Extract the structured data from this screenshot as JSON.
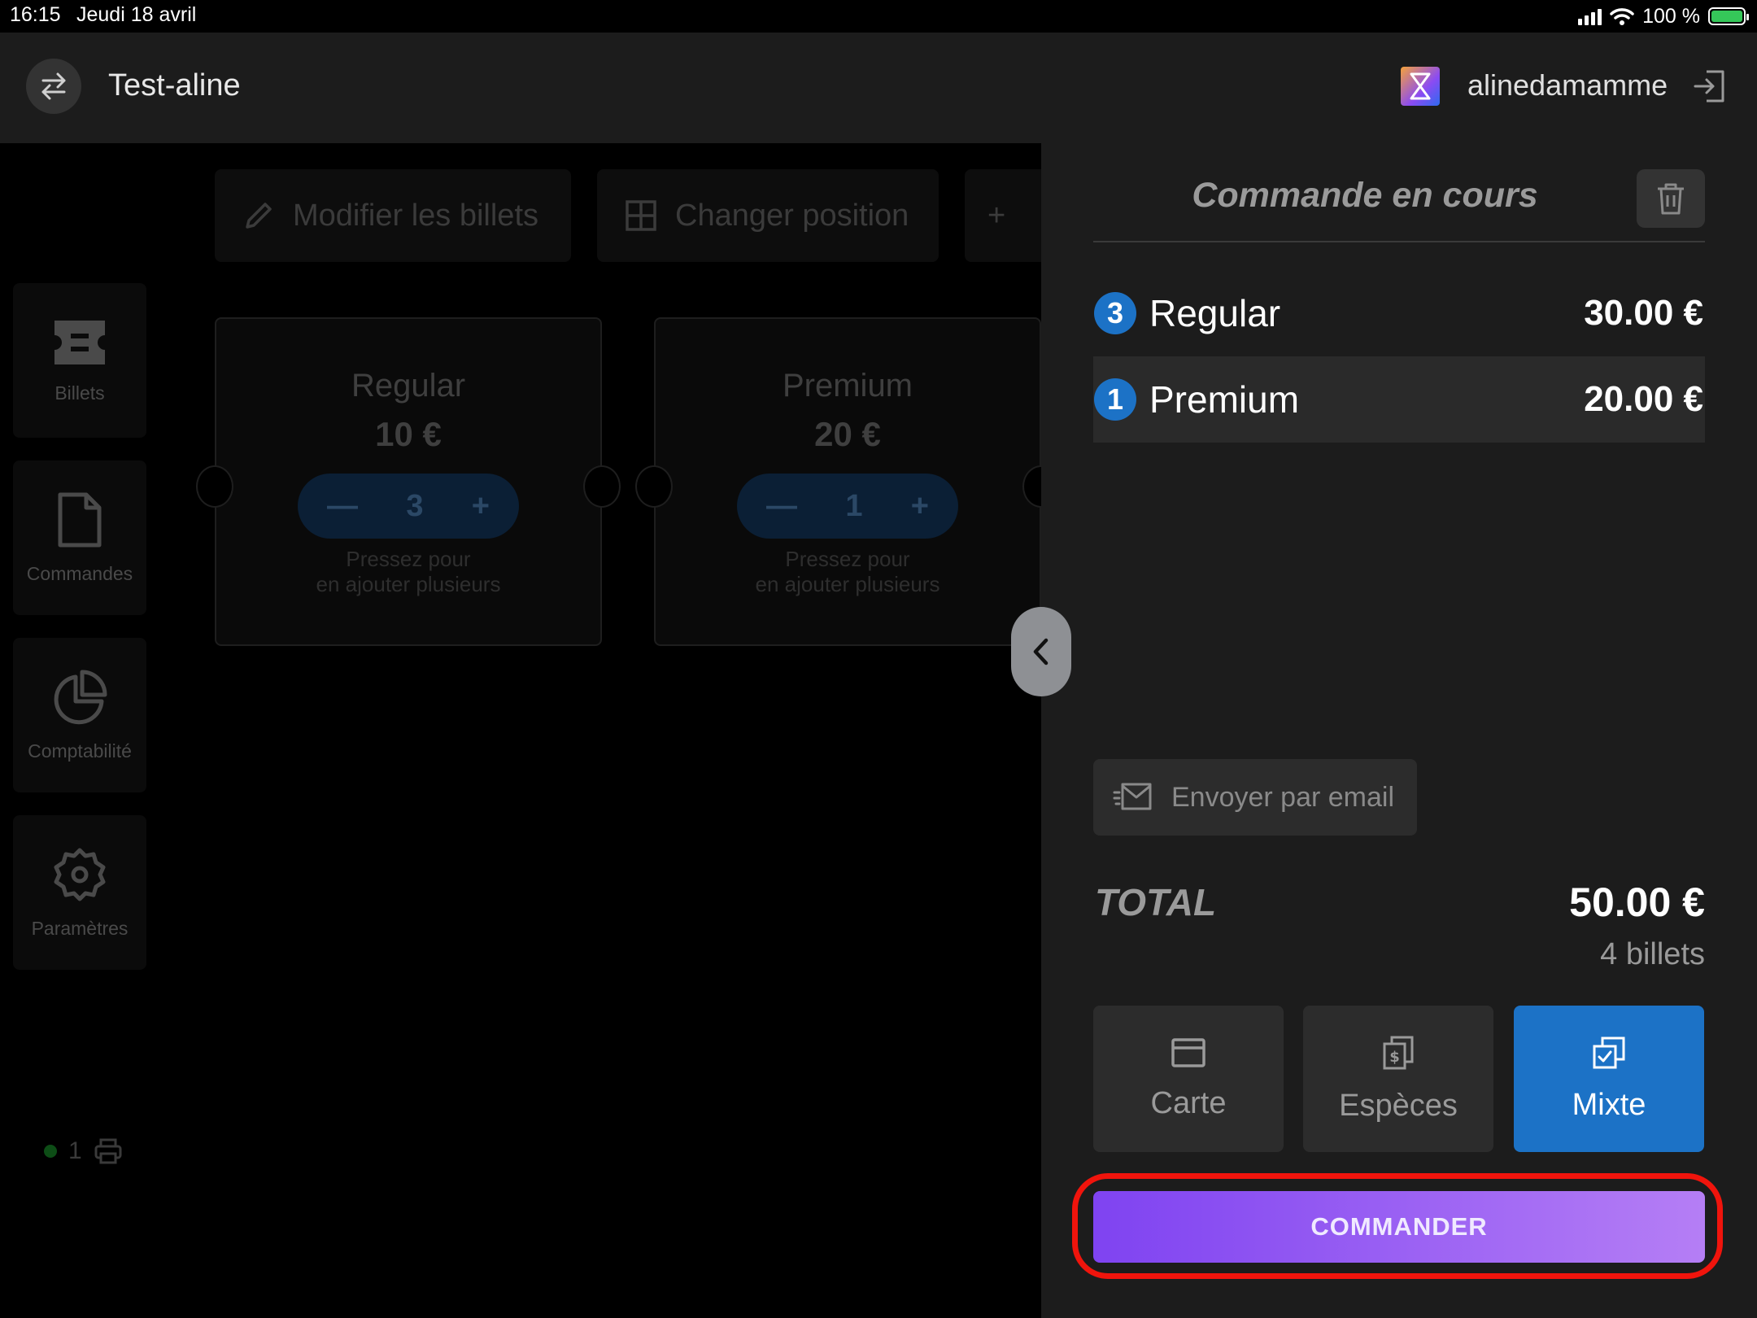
{
  "status_bar": {
    "time": "16:15",
    "date": "Jeudi 18 avril",
    "battery": "100 %"
  },
  "header": {
    "event_title": "Test-aline",
    "username": "alinedamamme"
  },
  "toolbar": {
    "edit_tickets": "Modifier les billets",
    "change_position": "Changer position",
    "add": "+"
  },
  "nav": {
    "items": [
      {
        "label": "Billets",
        "icon": "ticket-icon"
      },
      {
        "label": "Commandes",
        "icon": "document-icon"
      },
      {
        "label": "Comptabilité",
        "icon": "pie-chart-icon"
      },
      {
        "label": "Paramètres",
        "icon": "gear-icon"
      }
    ]
  },
  "tickets": [
    {
      "name": "Regular",
      "price": "10 €",
      "quantity": "3",
      "hint_line1": "Pressez pour",
      "hint_line2": "en ajouter plusieurs"
    },
    {
      "name": "Premium",
      "price": "20 €",
      "quantity": "1",
      "hint_line1": "Pressez pour",
      "hint_line2": "en ajouter plusieurs"
    }
  ],
  "printer": {
    "count": "1"
  },
  "order": {
    "title": "Commande en cours",
    "items": [
      {
        "qty": "3",
        "name": "Regular",
        "price": "30.00 €"
      },
      {
        "qty": "1",
        "name": "Premium",
        "price": "20.00 €"
      }
    ],
    "email_button": "Envoyer par email",
    "total_label": "TOTAL",
    "total_value": "50.00 €",
    "ticket_count": "4 billets",
    "payment_methods": [
      {
        "label": "Carte",
        "icon": "card-icon"
      },
      {
        "label": "Espèces",
        "icon": "cash-icon"
      },
      {
        "label": "Mixte",
        "icon": "mixed-payment-icon",
        "selected": true
      }
    ],
    "submit": "COMMANDER"
  },
  "colors": {
    "accent_blue": "#1c72c6",
    "order_gradient_start": "#7f43f1",
    "order_gradient_end": "#b57ef5",
    "highlight_red": "#f0140c"
  }
}
